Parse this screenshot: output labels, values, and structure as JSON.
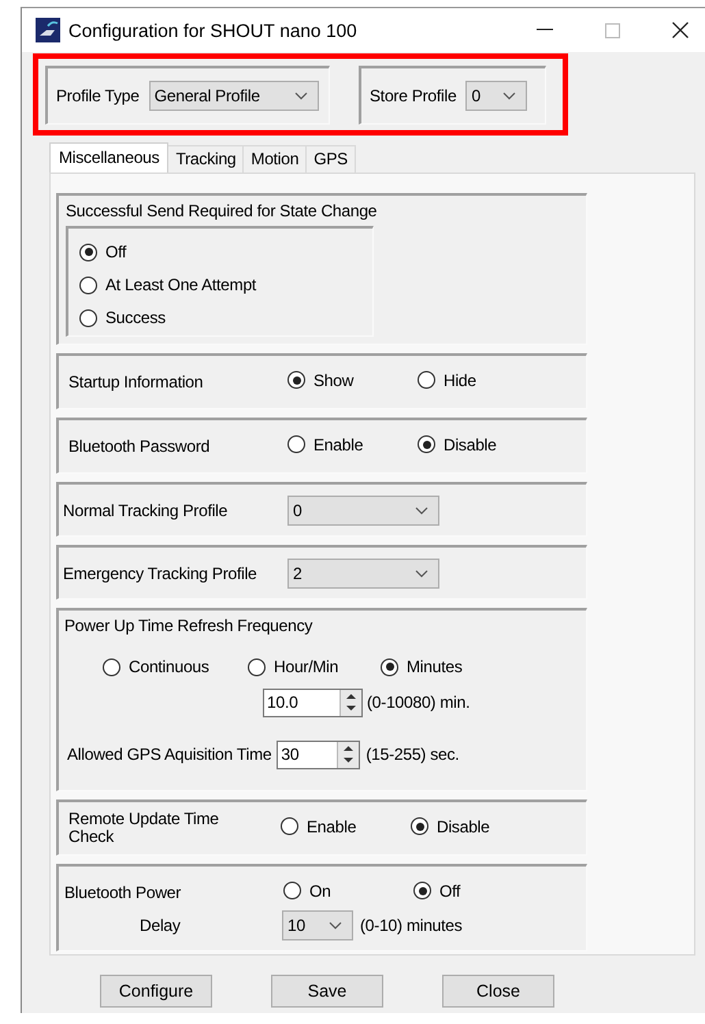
{
  "window": {
    "title": "Configuration for SHOUT nano 100"
  },
  "profile_bar": {
    "highlighted": true,
    "profile_type": {
      "label": "Profile Type",
      "value": "General Profile"
    },
    "store_profile": {
      "label": "Store Profile",
      "value": "0"
    }
  },
  "tabs": [
    {
      "label": "Miscellaneous",
      "selected": true
    },
    {
      "label": "Tracking",
      "selected": false
    },
    {
      "label": "Motion",
      "selected": false
    },
    {
      "label": "GPS",
      "selected": false
    }
  ],
  "sections": [
    {
      "kind": "radio_list",
      "title": "Successful Send Required for State Change",
      "options": [
        {
          "label": "Off",
          "selected": true
        },
        {
          "label": "At Least One Attempt",
          "selected": false
        },
        {
          "label": "Success",
          "selected": false
        }
      ]
    },
    {
      "kind": "radio_row",
      "label": "Startup Information",
      "options": [
        {
          "label": "Show",
          "selected": true
        },
        {
          "label": "Hide",
          "selected": false
        }
      ]
    },
    {
      "kind": "radio_row",
      "label": "Bluetooth Password",
      "options": [
        {
          "label": "Enable",
          "selected": false
        },
        {
          "label": "Disable",
          "selected": true
        }
      ]
    },
    {
      "kind": "dropdown",
      "label": "Normal Tracking Profile",
      "value": "0"
    },
    {
      "kind": "dropdown",
      "label": "Emergency Tracking Profile",
      "value": "2"
    },
    {
      "kind": "refresh",
      "title": "Power Up Time Refresh Frequency",
      "options": [
        {
          "label": "Continuous",
          "selected": false
        },
        {
          "label": "Hour/Min",
          "selected": false
        },
        {
          "label": "Minutes",
          "selected": true
        }
      ],
      "minutes": {
        "value": "10.0",
        "hint": "(0-10080) min."
      },
      "gps": {
        "label": "Allowed GPS Aquisition Time",
        "value": "30",
        "hint": "(15-255) sec."
      }
    },
    {
      "kind": "radio_row",
      "label": "Remote Update Time Check",
      "options": [
        {
          "label": "Enable",
          "selected": false
        },
        {
          "label": "Disable",
          "selected": true
        }
      ]
    },
    {
      "kind": "power",
      "label": "Bluetooth Power",
      "options": [
        {
          "label": "On",
          "selected": false
        },
        {
          "label": "Off",
          "selected": true
        }
      ],
      "delay": {
        "label": "Delay",
        "value": "10",
        "hint": "(0-10) minutes"
      }
    }
  ],
  "buttons": [
    "Configure",
    "Save",
    "Close"
  ]
}
